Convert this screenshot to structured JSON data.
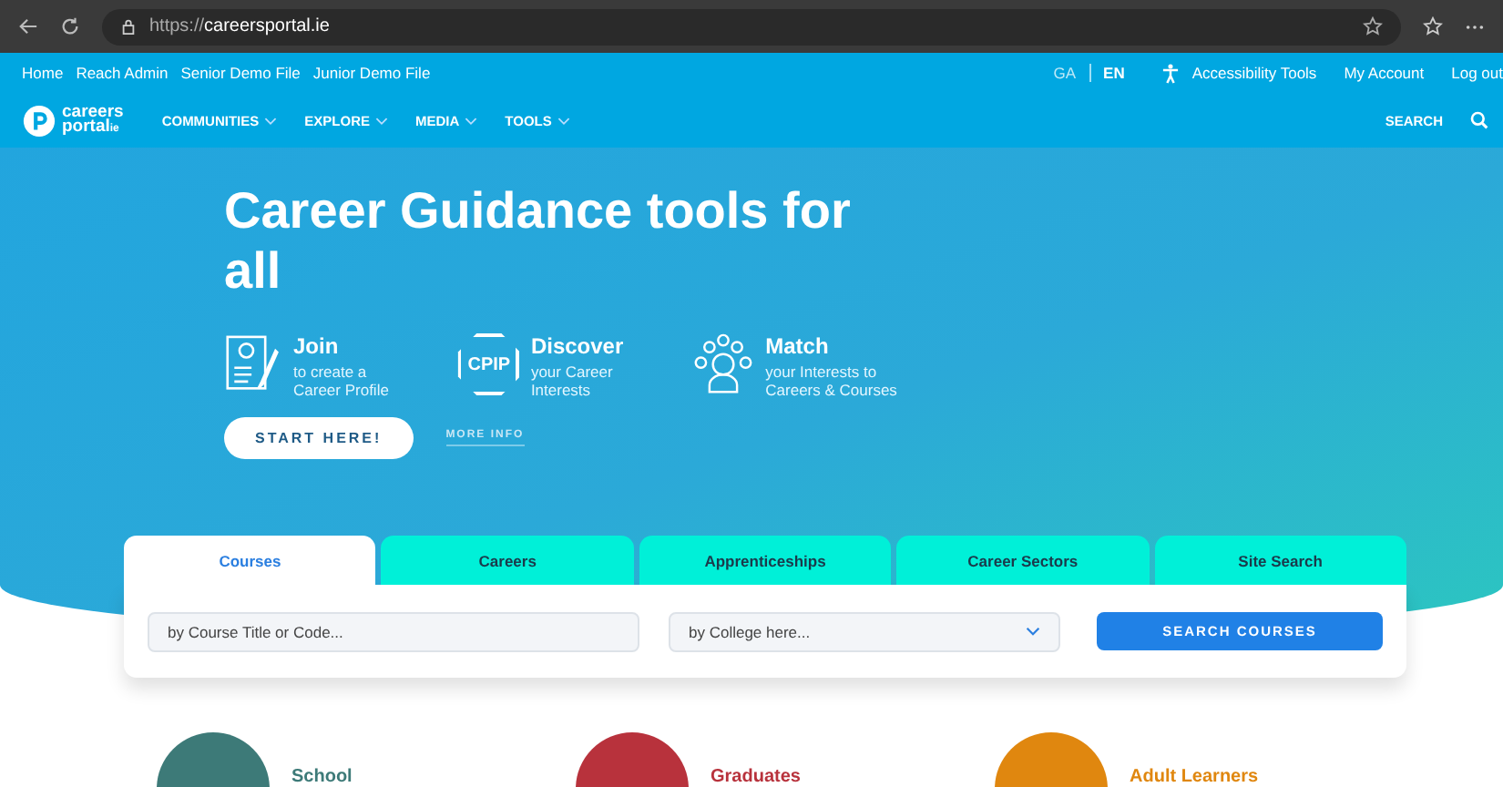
{
  "browser": {
    "url_prefix": "https://",
    "url_domain": "careersportal.ie"
  },
  "top_links": {
    "left": [
      "Home",
      "Reach Admin",
      "Senior Demo File",
      "Junior Demo File"
    ],
    "languages": [
      {
        "label": "GA",
        "selected": false
      },
      {
        "label": "EN",
        "selected": true
      }
    ],
    "accessibility": "Accessibility Tools",
    "right": [
      "My Account",
      "Log out"
    ]
  },
  "nav": {
    "logo_top": "careers",
    "logo_bottom": "portal",
    "logo_suffix": "ie",
    "items": [
      "COMMUNITIES",
      "EXPLORE",
      "MEDIA",
      "TOOLS"
    ],
    "search": "SEARCH"
  },
  "hero": {
    "title": "Career Guidance tools for all",
    "features": [
      {
        "kind": "profile",
        "title": "Join",
        "lines": [
          "to create a",
          "Career Profile"
        ]
      },
      {
        "kind": "cpip",
        "icon_text": "CPIP",
        "title": "Discover",
        "lines": [
          "your Career",
          "Interests"
        ]
      },
      {
        "kind": "match",
        "title": "Match",
        "lines": [
          "your Interests to",
          "Careers & Courses"
        ]
      }
    ],
    "start_button": "START HERE!",
    "more_link": "MORE INFO"
  },
  "search_tabs": [
    {
      "label": "Courses",
      "selected": true
    },
    {
      "label": "Careers",
      "selected": false
    },
    {
      "label": "Apprenticeships",
      "selected": false
    },
    {
      "label": "Career Sectors",
      "selected": false
    },
    {
      "label": "Site Search",
      "selected": false
    }
  ],
  "search_form": {
    "title_placeholder": "by Course Title or Code...",
    "college_placeholder": "by College here...",
    "button": "SEARCH COURSES"
  },
  "audiences": [
    {
      "label": "School",
      "color": "#3d7a78"
    },
    {
      "label": "Graduates",
      "color": "#b8323c"
    },
    {
      "label": "Adult Learners",
      "color": "#e0870f"
    }
  ]
}
